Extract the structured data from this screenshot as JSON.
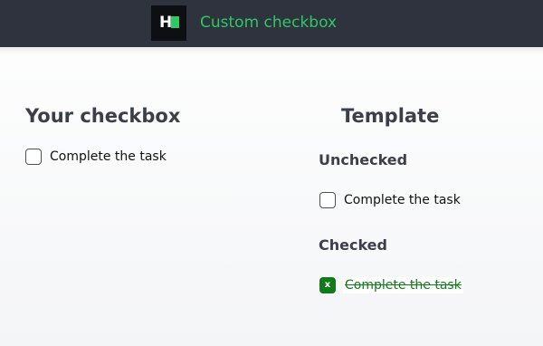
{
  "header": {
    "logo_letter": "H",
    "title": "Custom checkbox"
  },
  "left": {
    "heading": "Your checkbox",
    "checkbox": {
      "label": "Complete the task",
      "checked": false
    }
  },
  "right": {
    "heading": "Template",
    "unchecked": {
      "subheading": "Unchecked",
      "checkbox": {
        "label": "Complete the task",
        "checked": false
      }
    },
    "checked": {
      "subheading": "Checked",
      "checkbox": {
        "label": "Complete the task",
        "checked": true,
        "mark": "x"
      }
    }
  },
  "colors": {
    "topbar": "#2e333e",
    "brand_green": "#2ec866",
    "checked_green": "#127a1a"
  }
}
